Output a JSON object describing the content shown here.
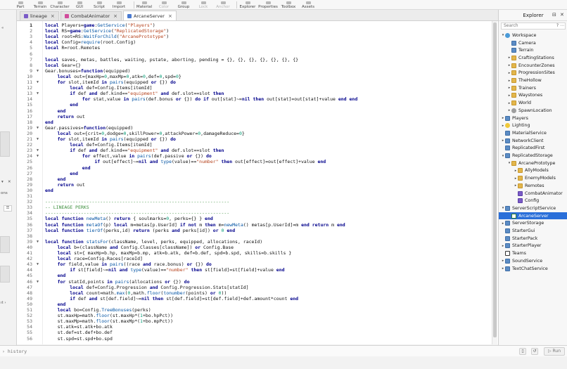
{
  "ribbon": {
    "tools": [
      {
        "label": "Part",
        "dim": false
      },
      {
        "label": "Terrain",
        "dim": false
      },
      {
        "label": "Character",
        "dim": false
      },
      {
        "label": "GUI",
        "dim": false
      },
      {
        "label": "Script",
        "dim": false
      },
      {
        "label": "Import",
        "dim": false
      },
      {
        "label": "Material",
        "dim": false
      },
      {
        "label": "Color",
        "dim": true
      },
      {
        "label": "Group",
        "dim": false
      },
      {
        "label": "Lock",
        "dim": true
      },
      {
        "label": "Anchor",
        "dim": true
      },
      {
        "label": "Explorer",
        "dim": false
      },
      {
        "label": "Properties",
        "dim": false
      },
      {
        "label": "Toolbox",
        "dim": false
      },
      {
        "label": "Assets",
        "dim": false
      }
    ]
  },
  "left_panel": {
    "partial_label": "ons",
    "icons": [
      "collapse-icon",
      "close-icon",
      "filter-icon"
    ],
    "partial_tail": "ıt ›"
  },
  "tabs": [
    {
      "label": "lineage",
      "icon": "module-icon",
      "color": "#7a5bc7",
      "active": false
    },
    {
      "label": "CombatAnimator",
      "icon": "module-icon",
      "color": "#d14c9c",
      "active": false
    },
    {
      "label": "ArcaneServer",
      "icon": "script-icon",
      "color": "#4a7bd1",
      "active": true
    }
  ],
  "editor": {
    "current_line": 1,
    "lines": [
      {
        "n": "1",
        "fold": "",
        "ind": 0,
        "html": "<span class='kw'>local</span> Players=<span class='kw'>game</span>:<span class='fn'>GetService</span>(<span class='str'>\"Players\"</span>)"
      },
      {
        "n": "2",
        "fold": "",
        "ind": 0,
        "html": "<span class='kw'>local</span> RS=<span class='kw'>game</span>:<span class='fn'>GetService</span>(<span class='str'>\"ReplicatedStorage\"</span>)"
      },
      {
        "n": "3",
        "fold": "",
        "ind": 0,
        "html": "<span class='kw'>local</span> root=RS:<span class='fn'>WaitForChild</span>(<span class='str'>\"ArcanePrototype\"</span>)"
      },
      {
        "n": "4",
        "fold": "",
        "ind": 0,
        "html": "<span class='kw'>local</span> Config=<span class='fn'>require</span>(root.Config)"
      },
      {
        "n": "5",
        "fold": "",
        "ind": 0,
        "html": "<span class='kw'>local</span> R=root.Remotes"
      },
      {
        "n": "6",
        "fold": "",
        "ind": 0,
        "html": ""
      },
      {
        "n": "7",
        "fold": "",
        "ind": 0,
        "html": "<span class='kw'>local</span> saves, metas, battles, waiting, pstate, aborting, pending = {}, {}, {}, {}, {}, {}, {}"
      },
      {
        "n": "8",
        "fold": "",
        "ind": 0,
        "html": "<span class='kw'>local</span> Gear={}"
      },
      {
        "n": "9",
        "fold": "v",
        "ind": 0,
        "html": "Gear.bonuses=<span class='kw'>function</span>(equipped)"
      },
      {
        "n": "10",
        "fold": "",
        "ind": 1,
        "html": "<span class='kw'>local</span> out={maxHp=<span class='num'>0</span>,maxMp=<span class='num'>0</span>,atk=<span class='num'>0</span>,def=<span class='num'>0</span>,spd=<span class='num'>0</span>}"
      },
      {
        "n": "11",
        "fold": "v",
        "ind": 1,
        "html": "<span class='kw'>for</span> slot,itemId <span class='kw'>in</span> <span class='fn'>pairs</span>(equipped <span class='kw'>or</span> {}) <span class='kw'>do</span>"
      },
      {
        "n": "12",
        "fold": "",
        "ind": 2,
        "html": "<span class='kw'>local</span> def=Config.Items[itemId]"
      },
      {
        "n": "13",
        "fold": "v",
        "ind": 2,
        "html": "<span class='kw'>if</span> def <span class='kw'>and</span> def.kind==<span class='str'>\"equipment\"</span> <span class='kw'>and</span> def.slot==slot <span class='kw'>then</span>"
      },
      {
        "n": "14",
        "fold": "",
        "ind": 3,
        "html": "<span class='kw'>for</span> stat,value <span class='kw'>in</span> <span class='fn'>pairs</span>(def.bonus <span class='kw'>or</span> {}) <span class='kw'>do</span> <span class='kw'>if</span> out[stat]~=<span class='kw'>nil</span> <span class='kw'>then</span> out[stat]=out[stat]+value <span class='kw'>end</span> <span class='kw'>end</span>"
      },
      {
        "n": "15",
        "fold": "",
        "ind": 2,
        "html": "<span class='kw'>end</span>"
      },
      {
        "n": "16",
        "fold": "",
        "ind": 1,
        "html": "<span class='kw'>end</span>"
      },
      {
        "n": "17",
        "fold": "",
        "ind": 1,
        "html": "<span class='kw'>return</span> out"
      },
      {
        "n": "18",
        "fold": "",
        "ind": 0,
        "html": "<span class='kw'>end</span>"
      },
      {
        "n": "19",
        "fold": "v",
        "ind": 0,
        "html": "Gear.passives=<span class='kw'>function</span>(equipped)"
      },
      {
        "n": "20",
        "fold": "",
        "ind": 1,
        "html": "<span class='kw'>local</span> out={crit=<span class='num'>0</span>,dodge=<span class='num'>0</span>,skillPower=<span class='num'>0</span>,attackPower=<span class='num'>0</span>,damageReduce=<span class='num'>0</span>}"
      },
      {
        "n": "21",
        "fold": "v",
        "ind": 1,
        "html": "<span class='kw'>for</span> slot,itemId <span class='kw'>in</span> <span class='fn'>pairs</span>(equipped <span class='kw'>or</span> {}) <span class='kw'>do</span>"
      },
      {
        "n": "22",
        "fold": "",
        "ind": 2,
        "html": "<span class='kw'>local</span> def=Config.Items[itemId]"
      },
      {
        "n": "23",
        "fold": "v",
        "ind": 2,
        "html": "<span class='kw'>if</span> def <span class='kw'>and</span> def.kind==<span class='str'>\"equipment\"</span> <span class='kw'>and</span> def.slot==slot <span class='kw'>then</span>"
      },
      {
        "n": "24",
        "fold": "v",
        "ind": 3,
        "html": "<span class='kw'>for</span> effect,value <span class='kw'>in</span> <span class='fn'>pairs</span>(def.passive <span class='kw'>or</span> {}) <span class='kw'>do</span>"
      },
      {
        "n": "25",
        "fold": "",
        "ind": 4,
        "html": "<span class='kw'>if</span> out[effect]~=<span class='kw'>nil</span> <span class='kw'>and</span> <span class='fn'>type</span>(value)==<span class='str'>\"number\"</span> <span class='kw'>then</span> out[effect]=out[effect]+value <span class='kw'>end</span>"
      },
      {
        "n": "26",
        "fold": "",
        "ind": 3,
        "html": "<span class='kw'>end</span>"
      },
      {
        "n": "27",
        "fold": "",
        "ind": 2,
        "html": "<span class='kw'>end</span>"
      },
      {
        "n": "28",
        "fold": "",
        "ind": 1,
        "html": "<span class='kw'>end</span>"
      },
      {
        "n": "29",
        "fold": "",
        "ind": 1,
        "html": "<span class='kw'>return</span> out"
      },
      {
        "n": "30",
        "fold": "",
        "ind": 0,
        "html": "<span class='kw'>end</span>"
      },
      {
        "n": "31",
        "fold": "",
        "ind": 0,
        "html": ""
      },
      {
        "n": "32",
        "fold": "",
        "ind": 0,
        "html": "<span class='cmt'>-------------------------------------------------------------------</span>"
      },
      {
        "n": "33",
        "fold": "",
        "ind": 0,
        "html": "<span class='cmt'>-- LINEAGE PERKS</span>"
      },
      {
        "n": "34",
        "fold": "",
        "ind": 0,
        "html": "<span class='cmt'>-------------------------------------------------------------------</span>"
      },
      {
        "n": "35",
        "fold": "",
        "ind": 0,
        "html": "<span class='kw'>local</span> <span class='kw'>function</span> <span class='fn'>newMeta</span>() <span class='kw'>return</span> { soulmarks=<span class='num'>0</span>, perks={} } <span class='kw'>end</span>"
      },
      {
        "n": "36",
        "fold": "",
        "ind": 0,
        "html": "<span class='kw'>local</span> <span class='kw'>function</span> <span class='fn'>metaOf</span>(p) <span class='kw'>local</span> m=metas[p.UserId] <span class='kw'>if</span> <span class='kw'>not</span> m <span class='kw'>then</span> m=<span class='fn'>newMeta</span>() metas[p.UserId]=m <span class='kw'>end</span> <span class='kw'>return</span> m <span class='kw'>end</span>"
      },
      {
        "n": "37",
        "fold": "",
        "ind": 0,
        "html": "<span class='kw'>local</span> <span class='kw'>function</span> <span class='fn'>tierOf</span>(perks,id) <span class='kw'>return</span> (perks <span class='kw'>and</span> perks[id]) <span class='kw'>or</span> <span class='num'>0</span> <span class='kw'>end</span>"
      },
      {
        "n": "38",
        "fold": "",
        "ind": 0,
        "html": ""
      },
      {
        "n": "39",
        "fold": "v",
        "ind": 0,
        "html": "<span class='kw'>local</span> <span class='kw'>function</span> <span class='fn'>statsFor</span>(className, level, perks, equipped, allocations, raceId)"
      },
      {
        "n": "40",
        "fold": "",
        "ind": 1,
        "html": "<span class='kw'>local</span> b=(className <span class='kw'>and</span> Config.Classes[className]) <span class='kw'>or</span> Config.Base"
      },
      {
        "n": "41",
        "fold": "",
        "ind": 1,
        "html": "<span class='kw'>local</span> st={ maxHp=b.hp, maxMp=b.mp, atk=b.atk, def=b.def, spd=b.spd, skills=b.skills }"
      },
      {
        "n": "42",
        "fold": "",
        "ind": 1,
        "html": "<span class='kw'>local</span> race=Config.Races[raceId]"
      },
      {
        "n": "43",
        "fold": "v",
        "ind": 1,
        "html": "<span class='kw'>for</span> field,value <span class='kw'>in</span> <span class='fn'>pairs</span>((race <span class='kw'>and</span> race.bonus) <span class='kw'>or</span> {}) <span class='kw'>do</span>"
      },
      {
        "n": "44",
        "fold": "",
        "ind": 2,
        "html": "<span class='kw'>if</span> st[field]~=<span class='kw'>nil</span> <span class='kw'>and</span> <span class='fn'>type</span>(value)==<span class='str'>\"number\"</span> <span class='kw'>then</span> st[field]=st[field]+value <span class='kw'>end</span>"
      },
      {
        "n": "45",
        "fold": "",
        "ind": 1,
        "html": "<span class='kw'>end</span>"
      },
      {
        "n": "46",
        "fold": "v",
        "ind": 1,
        "html": "<span class='kw'>for</span> statId,points <span class='kw'>in</span> <span class='fn'>pairs</span>(allocations <span class='kw'>or</span> {}) <span class='kw'>do</span>"
      },
      {
        "n": "47",
        "fold": "",
        "ind": 2,
        "html": "<span class='kw'>local</span> def=Config.Progression <span class='kw'>and</span> Config.Progression.Stats[statId]"
      },
      {
        "n": "48",
        "fold": "",
        "ind": 2,
        "html": "<span class='kw'>local</span> count=math.<span class='fn'>max</span>(<span class='num'>0</span>,math.<span class='fn'>floor</span>(<span class='fn'>tonumber</span>(points) <span class='kw'>or</span> <span class='num'>0</span>))"
      },
      {
        "n": "49",
        "fold": "",
        "ind": 2,
        "html": "<span class='kw'>if</span> def <span class='kw'>and</span> st[def.field]~=<span class='kw'>nil</span> <span class='kw'>then</span> st[def.field]=st[def.field]+def.amount*count <span class='kw'>end</span>"
      },
      {
        "n": "50",
        "fold": "",
        "ind": 1,
        "html": "<span class='kw'>end</span>"
      },
      {
        "n": "51",
        "fold": "",
        "ind": 1,
        "html": "<span class='kw'>local</span> bo=Config.<span class='fn'>TreeBonuses</span>(perks)"
      },
      {
        "n": "52",
        "fold": "",
        "ind": 1,
        "html": "st.maxHp=math.<span class='fn'>floor</span>(st.maxHp*(<span class='num'>1</span>+bo.hpPct))"
      },
      {
        "n": "53",
        "fold": "",
        "ind": 1,
        "html": "st.maxMp=math.<span class='fn'>floor</span>(st.maxMp*(<span class='num'>1</span>+bo.mpPct))"
      },
      {
        "n": "54",
        "fold": "",
        "ind": 1,
        "html": "st.atk=st.atk+bo.atk"
      },
      {
        "n": "55",
        "fold": "",
        "ind": 1,
        "html": "st.def=st.def+bo.def"
      },
      {
        "n": "56",
        "fold": "",
        "ind": 1,
        "html": "st.spd=st.spd+bo.spd"
      }
    ]
  },
  "explorer": {
    "title": "Explorer",
    "search_placeholder": "Search",
    "nodes": [
      {
        "label": "Workspace",
        "depth": 0,
        "arrow": "v",
        "icon": "globe",
        "selected": false
      },
      {
        "label": "Camera",
        "depth": 1,
        "arrow": "",
        "icon": "svc",
        "selected": false
      },
      {
        "label": "Terrain",
        "depth": 1,
        "arrow": "",
        "icon": "svc",
        "selected": false
      },
      {
        "label": "CraftingStations",
        "depth": 1,
        "arrow": ">",
        "icon": "folder",
        "selected": false
      },
      {
        "label": "EncounterZones",
        "depth": 1,
        "arrow": ">",
        "icon": "folder",
        "selected": false
      },
      {
        "label": "ProgressionSites",
        "depth": 1,
        "arrow": ">",
        "icon": "folder",
        "selected": false
      },
      {
        "label": "TheHollow",
        "depth": 1,
        "arrow": ">",
        "icon": "folder",
        "selected": false
      },
      {
        "label": "Trainers",
        "depth": 1,
        "arrow": ">",
        "icon": "folder",
        "selected": false
      },
      {
        "label": "Waystones",
        "depth": 1,
        "arrow": ">",
        "icon": "folder",
        "selected": false
      },
      {
        "label": "World",
        "depth": 1,
        "arrow": ">",
        "icon": "folder",
        "selected": false
      },
      {
        "label": "SpawnLocation",
        "depth": 1,
        "arrow": ">",
        "icon": "gear",
        "selected": false
      },
      {
        "label": "Players",
        "depth": 0,
        "arrow": ">",
        "icon": "svc",
        "selected": false
      },
      {
        "label": "Lighting",
        "depth": 0,
        "arrow": ">",
        "icon": "light",
        "selected": false
      },
      {
        "label": "MaterialService",
        "depth": 0,
        "arrow": "",
        "icon": "svc",
        "selected": false
      },
      {
        "label": "NetworkClient",
        "depth": 0,
        "arrow": ">",
        "icon": "svc",
        "selected": false
      },
      {
        "label": "ReplicatedFirst",
        "depth": 0,
        "arrow": "",
        "icon": "svc",
        "selected": false
      },
      {
        "label": "ReplicatedStorage",
        "depth": 0,
        "arrow": "v",
        "icon": "svc",
        "selected": false
      },
      {
        "label": "ArcanePrototype",
        "depth": 1,
        "arrow": "v",
        "icon": "folder",
        "selected": false
      },
      {
        "label": "AllyModels",
        "depth": 2,
        "arrow": ">",
        "icon": "folder",
        "selected": false
      },
      {
        "label": "EnemyModels",
        "depth": 2,
        "arrow": ">",
        "icon": "folder",
        "selected": false
      },
      {
        "label": "Remotes",
        "depth": 2,
        "arrow": ">",
        "icon": "folder",
        "selected": false
      },
      {
        "label": "CombatAnimator",
        "depth": 2,
        "arrow": "",
        "icon": "mod",
        "selected": false
      },
      {
        "label": "Config",
        "depth": 2,
        "arrow": "",
        "icon": "mod",
        "selected": false
      },
      {
        "label": "ServerScriptService",
        "depth": 0,
        "arrow": "v",
        "icon": "svc",
        "selected": false
      },
      {
        "label": "ArcaneServer",
        "depth": 1,
        "arrow": "",
        "icon": "script",
        "selected": true
      },
      {
        "label": "ServerStorage",
        "depth": 0,
        "arrow": ">",
        "icon": "svc",
        "selected": false
      },
      {
        "label": "StarterGui",
        "depth": 0,
        "arrow": "",
        "icon": "svc",
        "selected": false
      },
      {
        "label": "StarterPack",
        "depth": 0,
        "arrow": "",
        "icon": "svc",
        "selected": false
      },
      {
        "label": "StarterPlayer",
        "depth": 0,
        "arrow": ">",
        "icon": "svc",
        "selected": false
      },
      {
        "label": "Teams",
        "depth": 0,
        "arrow": "",
        "icon": "team",
        "selected": false
      },
      {
        "label": "SoundService",
        "depth": 0,
        "arrow": ">",
        "icon": "svc",
        "selected": false
      },
      {
        "label": "TextChatService",
        "depth": 0,
        "arrow": ">",
        "icon": "svc",
        "selected": false
      }
    ]
  },
  "command_bar": {
    "placeholder": "history",
    "run_label": "Run"
  },
  "colors": {
    "selection": "#2a6fd9",
    "keyword": "#00008b",
    "string": "#b5411b",
    "number": "#009a73",
    "comment": "#3c8f3c"
  }
}
